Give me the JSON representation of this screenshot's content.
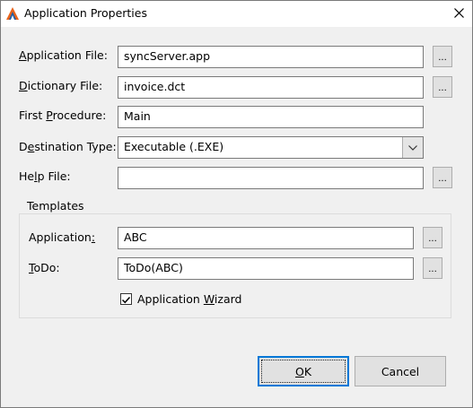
{
  "window": {
    "title": "Application Properties",
    "icon": "clarion-triangle-icon",
    "close_icon": "close-icon"
  },
  "form": {
    "application_file": {
      "label_pre": "",
      "label_key": "A",
      "label_post": "pplication File:",
      "value": "syncServer.app"
    },
    "dictionary_file": {
      "label_pre": "",
      "label_key": "D",
      "label_post": "ictionary File:",
      "value": "invoice.dct"
    },
    "first_procedure": {
      "label_pre": "First ",
      "label_key": "P",
      "label_post": "rocedure:",
      "value": "Main"
    },
    "destination_type": {
      "label_pre": "D",
      "label_key": "e",
      "label_post": "stination Type:",
      "value": "Executable (.EXE)"
    },
    "help_file": {
      "label_pre": "He",
      "label_key": "l",
      "label_post": "p File:",
      "value": ""
    },
    "browse_label": "..."
  },
  "templates": {
    "group_title": "Templates",
    "application": {
      "label_pre": "Application",
      "label_key": ":",
      "label_post": "",
      "value": "ABC"
    },
    "todo": {
      "label_pre": "",
      "label_key": "T",
      "label_post": "oDo:",
      "value": "ToDo(ABC)"
    },
    "wizard": {
      "label_pre": "Application ",
      "label_key": "W",
      "label_post": "izard",
      "checked": true
    }
  },
  "buttons": {
    "ok": {
      "label_key": "O",
      "label_post": "K"
    },
    "cancel": {
      "label": "Cancel"
    }
  },
  "colors": {
    "dialog_bg": "#f0f0f0",
    "accent": "#0078d7",
    "icon_orange": "#e8641b",
    "icon_blue": "#1f5fa8"
  }
}
